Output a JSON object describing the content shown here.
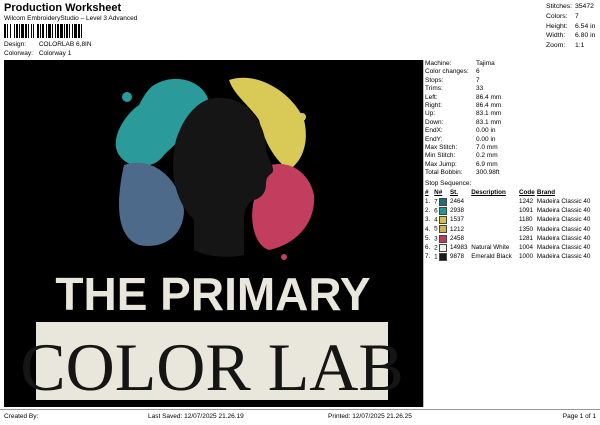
{
  "header": {
    "title": "Production Worksheet",
    "subtitle": "Wilcom EmbroideryStudio – Level 3 Advanced",
    "design_label": "Design:",
    "design_value": "COLORLAB 6,8IN",
    "colorway_label": "Colorway:",
    "colorway_value": "Colorway 1"
  },
  "stats": [
    {
      "k": "Stitches:",
      "v": "35472"
    },
    {
      "k": "Colors:",
      "v": "7"
    },
    {
      "k": "Height:",
      "v": "6.54 in"
    },
    {
      "k": "Width:",
      "v": "6.80 in"
    },
    {
      "k": "Zoom:",
      "v": "1:1"
    }
  ],
  "machine": [
    {
      "k": "Machine:",
      "v": "Tajima"
    },
    {
      "k": "Color changes:",
      "v": "6"
    },
    {
      "k": "Stops:",
      "v": "7"
    },
    {
      "k": "Trims:",
      "v": "33"
    },
    {
      "k": "Left:",
      "v": "86.4 mm"
    },
    {
      "k": "Right:",
      "v": "86.4 mm"
    },
    {
      "k": "Up:",
      "v": "83.1 mm"
    },
    {
      "k": "Down:",
      "v": "83.1 mm"
    },
    {
      "k": "EndX:",
      "v": "0.00 in"
    },
    {
      "k": "EndY:",
      "v": "0.00 in"
    },
    {
      "k": "Max Stitch:",
      "v": "7.0 mm"
    },
    {
      "k": "Min Stitch:",
      "v": "0.2 mm"
    },
    {
      "k": "Max Jump:",
      "v": "6.9 mm"
    },
    {
      "k": "Total Bobbin:",
      "v": "300.98ft"
    }
  ],
  "stop_sequence": {
    "title": "Stop Sequence:",
    "headers": [
      "#",
      "N#",
      "St.",
      "Description",
      "Code",
      "Brand"
    ],
    "rows": [
      {
        "n": "1.",
        "num": "7",
        "color": "#1f6f7a",
        "st": "2464",
        "desc": "",
        "code": "1242",
        "brand": "Madeira Classic 40"
      },
      {
        "n": "2.",
        "num": "6",
        "color": "#1f9a90",
        "st": "2938",
        "desc": "",
        "code": "1091",
        "brand": "Madeira Classic 40"
      },
      {
        "n": "3.",
        "num": "4",
        "color": "#d2c24a",
        "st": "1537",
        "desc": "",
        "code": "1180",
        "brand": "Madeira Classic 40"
      },
      {
        "n": "4.",
        "num": "5",
        "color": "#c9b64a",
        "st": "1212",
        "desc": "",
        "code": "1350",
        "brand": "Madeira Classic 40"
      },
      {
        "n": "5.",
        "num": "3",
        "color": "#c03a5a",
        "st": "2458",
        "desc": "",
        "code": "1281",
        "brand": "Madeira Classic 40"
      },
      {
        "n": "6.",
        "num": "2",
        "color": "#f2f0e6",
        "st": "14983",
        "desc": "Natural White",
        "code": "1004",
        "brand": "Madeira Classic 40"
      },
      {
        "n": "7.",
        "num": "1",
        "color": "#1a1a1a",
        "st": "9878",
        "desc": "Emerald Black",
        "code": "1000",
        "brand": "Madeira Classic 40"
      }
    ]
  },
  "design_art": {
    "line1": "THE PRIMARY",
    "line2": "COLOR LAB",
    "colors": {
      "teal": "#2a9a9a",
      "slate": "#4d6a8a",
      "yellow": "#d9c957",
      "red": "#c23d5e",
      "white": "#e9e7dc",
      "black": "#000000",
      "silhouette": "#151515"
    }
  },
  "footer": {
    "created": "Created By:",
    "saved": "Last Saved: 12/07/2025 21.26.19",
    "printed": "Printed: 12/07/2025 21.26.25",
    "page": "Page 1 of 1"
  }
}
